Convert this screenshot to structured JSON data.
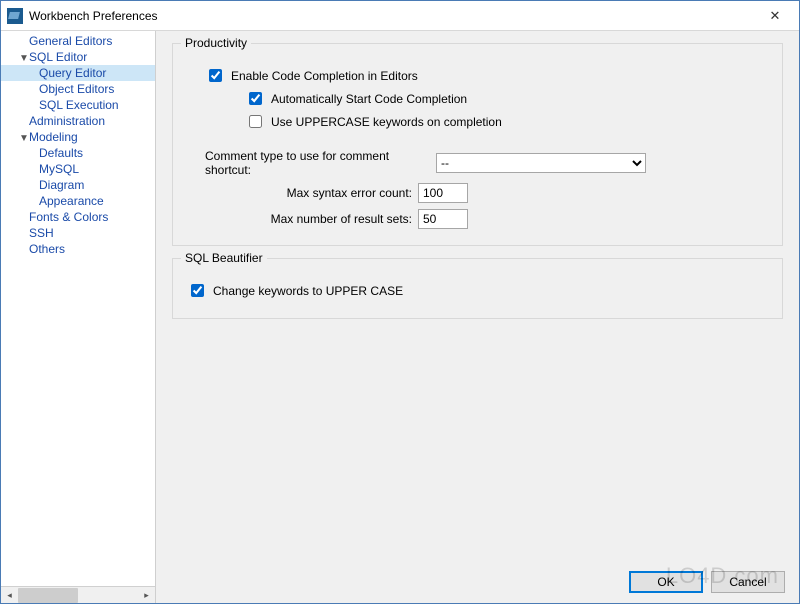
{
  "window": {
    "title": "Workbench Preferences"
  },
  "sidebar": {
    "items": [
      {
        "label": "General Editors",
        "level": 1,
        "expandable": false
      },
      {
        "label": "SQL Editor",
        "level": 1,
        "expandable": true,
        "expanded": true
      },
      {
        "label": "Query Editor",
        "level": 2,
        "selected": true
      },
      {
        "label": "Object Editors",
        "level": 2
      },
      {
        "label": "SQL Execution",
        "level": 2
      },
      {
        "label": "Administration",
        "level": 1,
        "expandable": false
      },
      {
        "label": "Modeling",
        "level": 1,
        "expandable": true,
        "expanded": true
      },
      {
        "label": "Defaults",
        "level": 2
      },
      {
        "label": "MySQL",
        "level": 2
      },
      {
        "label": "Diagram",
        "level": 2
      },
      {
        "label": "Appearance",
        "level": 2
      },
      {
        "label": "Fonts & Colors",
        "level": 1,
        "expandable": false
      },
      {
        "label": "SSH",
        "level": 1,
        "expandable": false
      },
      {
        "label": "Others",
        "level": 1,
        "expandable": false
      }
    ]
  },
  "productivity": {
    "legend": "Productivity",
    "enable_cc_label": "Enable Code Completion in Editors",
    "enable_cc_checked": true,
    "auto_start_label": "Automatically Start Code Completion",
    "auto_start_checked": true,
    "uppercase_label": "Use UPPERCASE keywords on completion",
    "uppercase_checked": false,
    "comment_type_label": "Comment type to use for comment shortcut:",
    "comment_type_value": "--",
    "max_syntax_label": "Max syntax error count:",
    "max_syntax_value": "100",
    "max_results_label": "Max number of result sets:",
    "max_results_value": "50"
  },
  "beautifier": {
    "legend": "SQL Beautifier",
    "upper_label": "Change keywords to UPPER CASE",
    "upper_checked": true
  },
  "footer": {
    "ok": "OK",
    "cancel": "Cancel"
  },
  "watermark": "LO4D.com"
}
